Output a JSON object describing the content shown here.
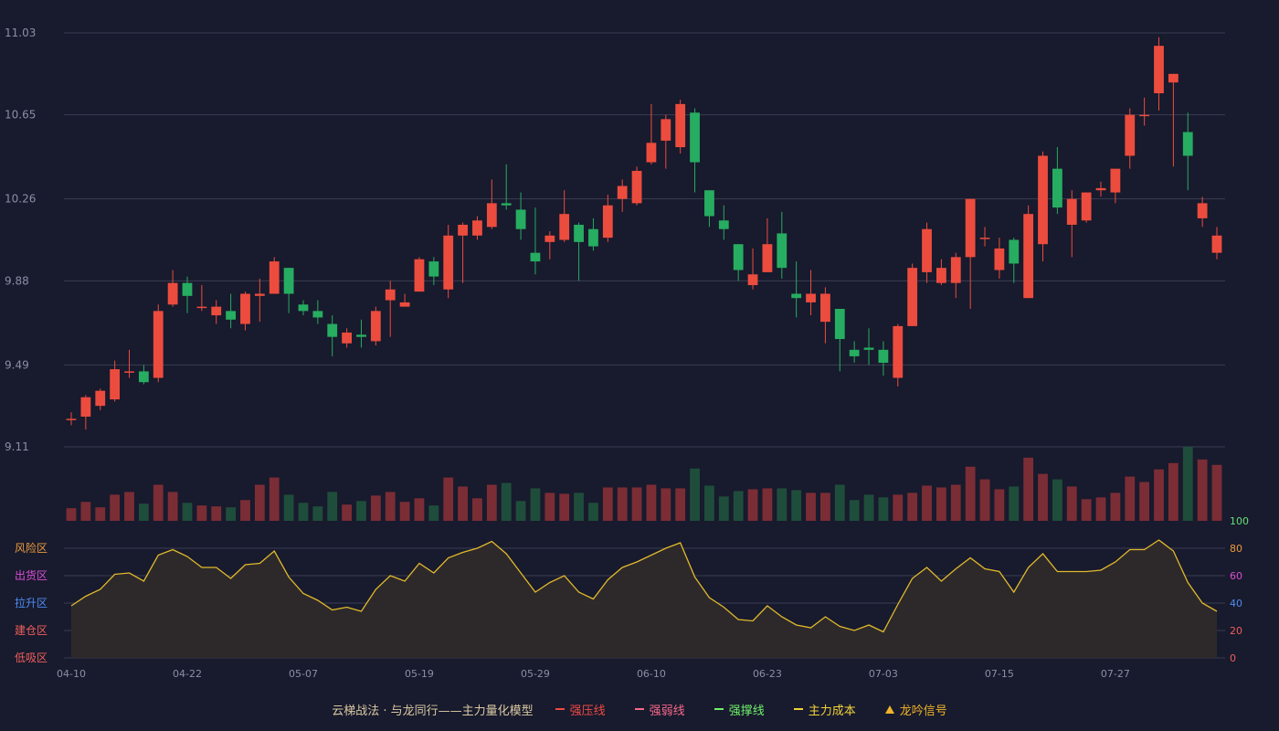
{
  "colors": {
    "background": "#181a2d",
    "up": "#ec4c3e",
    "down": "#26ad61",
    "up_volume": "#7b2d35",
    "down_volume": "#1f4d3b",
    "grid": "#3a3c52",
    "axis_text": "#8b8fa6",
    "indicator_line": "#e0b92a",
    "indicator_fill": "#2e2a2b",
    "zone_risk": "#e89a3c",
    "zone_distribute": "#d94fd3",
    "zone_pull": "#4e8cf0",
    "zone_build": "#ee5f5b",
    "zone_low": "#ee5f5b"
  },
  "legend": {
    "title": "云梯战法 · 与龙同行——主力量化模型",
    "items": [
      {
        "label": "强压线",
        "color": "#ee4a44",
        "style": "solid"
      },
      {
        "label": "强弱线",
        "color": "#f56a8a",
        "style": "dashed"
      },
      {
        "label": "强撑线",
        "color": "#6ff06a",
        "style": "solid"
      },
      {
        "label": "主力成本",
        "color": "#f0d23a",
        "style": "dashed"
      },
      {
        "label": "龙吟信号",
        "color": "#f0b32a",
        "style": "triangle",
        "icon": "triangle-up-icon"
      }
    ]
  },
  "chart_data": [
    {
      "type": "candlestick",
      "yticks": [
        "11.03",
        "10.65",
        "10.26",
        "9.88",
        "9.49",
        "9.11"
      ],
      "ylim": [
        9.11,
        11.03
      ],
      "xticks": [
        "04-10",
        "04-22",
        "05-07",
        "05-19",
        "05-29",
        "06-10",
        "06-23",
        "07-03",
        "07-15",
        "07-27"
      ],
      "xtick_index": [
        0,
        8,
        16,
        24,
        32,
        40,
        48,
        56,
        64,
        72
      ],
      "candles": [
        [
          9.24,
          9.24,
          9.27,
          9.21
        ],
        [
          9.25,
          9.34,
          9.35,
          9.19
        ],
        [
          9.3,
          9.37,
          9.38,
          9.28
        ],
        [
          9.33,
          9.47,
          9.51,
          9.32
        ],
        [
          9.46,
          9.46,
          9.56,
          9.43
        ],
        [
          9.46,
          9.41,
          9.49,
          9.4
        ],
        [
          9.43,
          9.74,
          9.77,
          9.41
        ],
        [
          9.77,
          9.87,
          9.93,
          9.76
        ],
        [
          9.87,
          9.81,
          9.9,
          9.73
        ],
        [
          9.76,
          9.76,
          9.86,
          9.74
        ],
        [
          9.72,
          9.76,
          9.79,
          9.68
        ],
        [
          9.74,
          9.7,
          9.82,
          9.66
        ],
        [
          9.68,
          9.82,
          9.83,
          9.65
        ],
        [
          9.81,
          9.82,
          9.89,
          9.69
        ],
        [
          9.82,
          9.97,
          9.99,
          9.82
        ],
        [
          9.94,
          9.82,
          9.94,
          9.73
        ],
        [
          9.77,
          9.74,
          9.79,
          9.72
        ],
        [
          9.74,
          9.71,
          9.79,
          9.68
        ],
        [
          9.68,
          9.62,
          9.72,
          9.53
        ],
        [
          9.59,
          9.64,
          9.66,
          9.57
        ],
        [
          9.63,
          9.62,
          9.7,
          9.57
        ],
        [
          9.6,
          9.74,
          9.76,
          9.58
        ],
        [
          9.79,
          9.84,
          9.88,
          9.62
        ],
        [
          9.76,
          9.78,
          9.82,
          9.77
        ],
        [
          9.83,
          9.98,
          9.99,
          9.83
        ],
        [
          9.97,
          9.9,
          9.99,
          9.86
        ],
        [
          9.84,
          10.09,
          10.14,
          9.8
        ],
        [
          10.09,
          10.14,
          10.15,
          9.87
        ],
        [
          10.09,
          10.16,
          10.18,
          10.07
        ],
        [
          10.13,
          10.24,
          10.35,
          10.12
        ],
        [
          10.24,
          10.23,
          10.42,
          10.21
        ],
        [
          10.21,
          10.12,
          10.29,
          10.07
        ],
        [
          10.01,
          9.97,
          10.22,
          9.91
        ],
        [
          10.06,
          10.09,
          10.11,
          9.98
        ],
        [
          10.07,
          10.19,
          10.3,
          10.06
        ],
        [
          10.14,
          10.06,
          10.15,
          9.88
        ],
        [
          10.12,
          10.04,
          10.17,
          10.02
        ],
        [
          10.08,
          10.23,
          10.28,
          10.06
        ],
        [
          10.26,
          10.32,
          10.35,
          10.2
        ],
        [
          10.24,
          10.39,
          10.41,
          10.23
        ],
        [
          10.43,
          10.52,
          10.7,
          10.42
        ],
        [
          10.53,
          10.63,
          10.65,
          10.4
        ],
        [
          10.5,
          10.7,
          10.72,
          10.47
        ],
        [
          10.66,
          10.43,
          10.68,
          10.29
        ],
        [
          10.3,
          10.18,
          10.3,
          10.13
        ],
        [
          10.16,
          10.12,
          10.23,
          10.07
        ],
        [
          10.05,
          9.93,
          10.05,
          9.88
        ],
        [
          9.86,
          9.91,
          10.03,
          9.84
        ],
        [
          9.92,
          10.05,
          10.17,
          9.92
        ],
        [
          10.1,
          9.94,
          10.2,
          9.89
        ],
        [
          9.82,
          9.8,
          9.97,
          9.71
        ],
        [
          9.78,
          9.82,
          9.93,
          9.72
        ],
        [
          9.69,
          9.82,
          9.85,
          9.59
        ],
        [
          9.75,
          9.61,
          9.75,
          9.46
        ],
        [
          9.56,
          9.53,
          9.6,
          9.5
        ],
        [
          9.57,
          9.56,
          9.66,
          9.49
        ],
        [
          9.56,
          9.5,
          9.6,
          9.44
        ],
        [
          9.43,
          9.67,
          9.68,
          9.39
        ],
        [
          9.67,
          9.94,
          9.96,
          9.67
        ],
        [
          9.92,
          10.12,
          10.15,
          9.87
        ],
        [
          9.87,
          9.94,
          9.98,
          9.86
        ],
        [
          9.87,
          9.99,
          10.01,
          9.8
        ],
        [
          9.99,
          10.26,
          10.26,
          9.75
        ],
        [
          10.08,
          10.08,
          10.13,
          10.04
        ],
        [
          9.93,
          10.03,
          10.08,
          9.89
        ],
        [
          10.07,
          9.96,
          10.08,
          9.87
        ],
        [
          9.8,
          10.19,
          10.23,
          9.8
        ],
        [
          10.05,
          10.46,
          10.48,
          9.97
        ],
        [
          10.4,
          10.22,
          10.5,
          10.19
        ],
        [
          10.14,
          10.26,
          10.3,
          9.99
        ],
        [
          10.16,
          10.29,
          10.29,
          10.15
        ],
        [
          10.3,
          10.31,
          10.34,
          10.27
        ],
        [
          10.29,
          10.4,
          10.39,
          10.24
        ],
        [
          10.46,
          10.65,
          10.68,
          10.4
        ],
        [
          10.65,
          10.65,
          10.73,
          10.6
        ],
        [
          10.75,
          10.97,
          11.01,
          10.67
        ],
        [
          10.8,
          10.84,
          10.84,
          10.41
        ],
        [
          10.57,
          10.46,
          10.66,
          10.3
        ],
        [
          10.17,
          10.24,
          10.27,
          10.13
        ],
        [
          10.01,
          10.09,
          10.13,
          9.98
        ]
      ]
    },
    {
      "type": "bar",
      "name": "volume",
      "values": [
        14,
        21,
        15,
        29,
        32,
        19,
        40,
        32,
        20,
        17,
        16,
        15,
        23,
        40,
        48,
        29,
        20,
        16,
        32,
        18,
        22,
        28,
        32,
        21,
        25,
        17,
        48,
        38,
        25,
        40,
        42,
        22,
        36,
        31,
        30,
        31,
        20,
        37,
        37,
        37,
        40,
        36,
        36,
        58,
        39,
        27,
        33,
        35,
        36,
        36,
        34,
        31,
        31,
        40,
        23,
        29,
        26,
        29,
        31,
        39,
        37,
        40,
        60,
        46,
        35,
        38,
        70,
        52,
        46,
        38,
        24,
        26,
        31,
        49,
        43,
        57,
        64,
        82,
        68,
        62
      ]
    },
    {
      "type": "area",
      "yticks": [
        "100",
        "80",
        "60",
        "40",
        "20",
        "0"
      ],
      "ylim": [
        0,
        100
      ],
      "zones": [
        "风险区",
        "出货区",
        "拉升区",
        "建仓区",
        "低吸区"
      ],
      "values": [
        38,
        45,
        50,
        61,
        62,
        56,
        75,
        79,
        74,
        66,
        66,
        58,
        68,
        69,
        78,
        59,
        47,
        42,
        35,
        37,
        34,
        50,
        60,
        56,
        69,
        62,
        73,
        77,
        80,
        85,
        76,
        62,
        48,
        55,
        60,
        48,
        43,
        57,
        66,
        70,
        75,
        80,
        84,
        59,
        44,
        37,
        28,
        27,
        38,
        30,
        24,
        22,
        30,
        23,
        20,
        24,
        19,
        39,
        58,
        66,
        56,
        65,
        73,
        65,
        63,
        48,
        66,
        76,
        63,
        63,
        63,
        64,
        70,
        79,
        79,
        86,
        78,
        55,
        40,
        34
      ]
    }
  ]
}
